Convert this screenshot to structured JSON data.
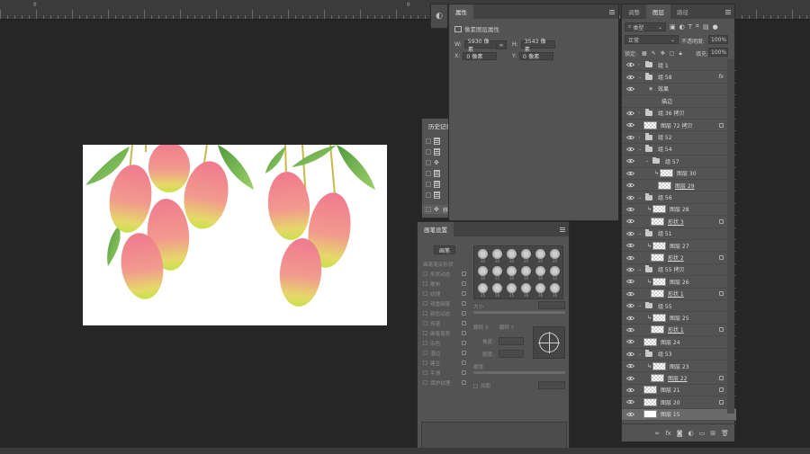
{
  "ruler": {
    "labels": [
      "0",
      "0"
    ]
  },
  "properties_panel": {
    "tab": "属性",
    "header": "像素图层属性",
    "w_label": "W:",
    "w_value": "5930 像素",
    "h_label": "H:",
    "h_value": "3543 像素",
    "x_label": "X:",
    "x_value": "0 像素",
    "y_label": "Y:",
    "y_value": "0 像素"
  },
  "history_panel": {
    "tab": "历史记录",
    "rows": [
      "",
      "",
      "",
      "",
      "",
      "",
      "移动"
    ]
  },
  "brush_panel": {
    "tab": "画笔设置",
    "preset_button": "画笔",
    "header_item": "画笔笔尖形状",
    "options": [
      "形状动态",
      "散布",
      "纹理",
      "双重画笔",
      "颜色动态",
      "传递",
      "画笔笔势",
      "杂色",
      "湿边",
      "建立",
      "平滑",
      "保护纹理"
    ],
    "tip_sizes": [
      "30",
      "30",
      "30",
      "25",
      "25",
      "25",
      "36",
      "25",
      "36",
      "36",
      "36",
      "32",
      "25",
      "50",
      "25",
      "36",
      "36",
      "36"
    ],
    "size_label": "大小",
    "flip_x": "翻转 X",
    "flip_y": "翻转 Y",
    "angle_label": "角度:",
    "roundness_label": "圆度:",
    "hardness_label": "硬度",
    "spacing_label": "间距"
  },
  "layers_panel": {
    "tabs": [
      "调整",
      "图层",
      "路径"
    ],
    "active_tab": "图层",
    "filter_kind": "类型",
    "blend_mode": "正常",
    "opacity_label": "不透明度:",
    "opacity_value": "100%",
    "lock_label": "锁定:",
    "fill_label": "填充:",
    "fill_value": "100%",
    "layers": [
      {
        "name": "组 1",
        "type": "group",
        "indent": 0
      },
      {
        "name": "组 58",
        "type": "group",
        "indent": 0,
        "fx": true,
        "expanded": true
      },
      {
        "name": "效果",
        "type": "effects",
        "indent": 1
      },
      {
        "name": "描边",
        "type": "effect",
        "indent": 2
      },
      {
        "name": "组 36 拷贝",
        "type": "group",
        "indent": 0
      },
      {
        "name": "图层 72 拷贝",
        "type": "layer",
        "indent": 0,
        "lock": true
      },
      {
        "name": "组 52",
        "type": "group",
        "indent": 0
      },
      {
        "name": "组 54",
        "type": "group",
        "indent": 0,
        "expanded": true
      },
      {
        "name": "组 57",
        "type": "group",
        "indent": 1,
        "expanded": true
      },
      {
        "name": "图层 30",
        "type": "layer",
        "indent": 2,
        "clip": true
      },
      {
        "name": "图层 29",
        "type": "layer",
        "indent": 2,
        "underline": true
      },
      {
        "name": "组 56",
        "type": "group",
        "indent": 0,
        "expanded": true
      },
      {
        "name": "图层 28",
        "type": "layer",
        "indent": 1,
        "clip": true
      },
      {
        "name": "形状 3",
        "type": "layer",
        "indent": 1,
        "underline": true,
        "lock": true
      },
      {
        "name": "组 51",
        "type": "group",
        "indent": 0,
        "expanded": true
      },
      {
        "name": "图层 27",
        "type": "layer",
        "indent": 1,
        "clip": true
      },
      {
        "name": "形状 2",
        "type": "layer",
        "indent": 1,
        "underline": true,
        "lock": true
      },
      {
        "name": "组 55 拷贝",
        "type": "group",
        "indent": 0,
        "expanded": true
      },
      {
        "name": "图层 26",
        "type": "layer",
        "indent": 1,
        "clip": true
      },
      {
        "name": "形状 1",
        "type": "layer",
        "indent": 1,
        "underline": true,
        "lock": true
      },
      {
        "name": "组 55",
        "type": "group",
        "indent": 0,
        "expanded": true
      },
      {
        "name": "图层 25",
        "type": "layer",
        "indent": 1,
        "clip": true
      },
      {
        "name": "形状 1",
        "type": "layer",
        "indent": 1,
        "underline": true,
        "lock": true
      },
      {
        "name": "图层 24",
        "type": "layer",
        "indent": 0
      },
      {
        "name": "组 53",
        "type": "group",
        "indent": 0,
        "expanded": true
      },
      {
        "name": "图层 23",
        "type": "layer",
        "indent": 1,
        "clip": true
      },
      {
        "name": "图层 22",
        "type": "layer",
        "indent": 1,
        "underline": true,
        "lock": true
      },
      {
        "name": "图层 21",
        "type": "layer",
        "indent": 0,
        "lock": true
      },
      {
        "name": "图层 20",
        "type": "layer",
        "indent": 0,
        "lock": true
      },
      {
        "name": "图层 15",
        "type": "layer",
        "indent": 0,
        "selected": true,
        "white": true
      }
    ],
    "footer_icons": [
      "link-icon",
      "fx-icon",
      "mask-icon",
      "adjustment-icon",
      "folder-icon",
      "new-layer-icon",
      "trash-icon"
    ],
    "footer_fx": "fx"
  },
  "colors": {
    "background": "#262626",
    "panel": "#535353",
    "canvas": "#ffffff",
    "mango": "#f08090",
    "leaf": "#6db84a"
  }
}
